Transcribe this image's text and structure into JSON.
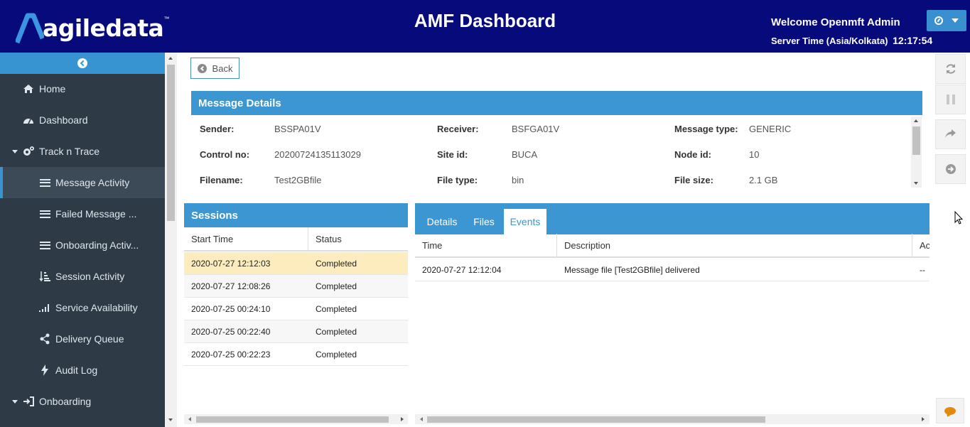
{
  "header": {
    "logo_text": "agiledata",
    "logo_tm": "™",
    "title": "AMF Dashboard",
    "welcome": "Welcome Openmft Admin",
    "server_time_label": "Server Time (Asia/Kolkata)",
    "server_time_value": "12:17:54",
    "user_icon": "dashboard-gauge-icon"
  },
  "sidebar": {
    "items": [
      {
        "label": "Home",
        "icon": "home-icon"
      },
      {
        "label": "Dashboard",
        "icon": "dashboard-icon"
      },
      {
        "label": "Track n Trace",
        "icon": "gears-icon"
      },
      {
        "label": "Message Activity",
        "icon": "bars-icon"
      },
      {
        "label": "Failed Message ...",
        "icon": "bars-icon"
      },
      {
        "label": "Onboarding Activ...",
        "icon": "bars-icon"
      },
      {
        "label": "Session Activity",
        "icon": "sort-amount-icon"
      },
      {
        "label": "Service Availability",
        "icon": "signal-icon"
      },
      {
        "label": "Delivery Queue",
        "icon": "share-alt-icon"
      },
      {
        "label": "Audit Log",
        "icon": "bolt-icon"
      },
      {
        "label": "Onboarding",
        "icon": "sign-in-icon"
      }
    ]
  },
  "back_button": {
    "label": "Back"
  },
  "message_details": {
    "title": "Message Details",
    "fields": [
      {
        "label": "Sender:",
        "value": "BSSPA01V"
      },
      {
        "label": "Receiver:",
        "value": "BSFGA01V"
      },
      {
        "label": "Message type:",
        "value": "GENERIC"
      },
      {
        "label": "Control no:",
        "value": "20200724135113029"
      },
      {
        "label": "Site id:",
        "value": "BUCA"
      },
      {
        "label": "Node id:",
        "value": "10"
      },
      {
        "label": "Filename:",
        "value": "Test2GBfile"
      },
      {
        "label": "File type:",
        "value": "bin"
      },
      {
        "label": "File size:",
        "value": "2.1 GB"
      }
    ]
  },
  "sessions": {
    "title": "Sessions",
    "columns": [
      "Start Time",
      "Status"
    ],
    "rows": [
      {
        "start_time": "2020-07-27 12:12:03",
        "status": "Completed"
      },
      {
        "start_time": "2020-07-27 12:08:26",
        "status": "Completed"
      },
      {
        "start_time": "2020-07-25 00:24:10",
        "status": "Completed"
      },
      {
        "start_time": "2020-07-25 00:22:40",
        "status": "Completed"
      },
      {
        "start_time": "2020-07-25 00:22:23",
        "status": "Completed"
      }
    ]
  },
  "detail_tabs": {
    "tabs": [
      "Details",
      "Files",
      "Events"
    ],
    "active": "Events",
    "columns": [
      "Time",
      "Description",
      "Ac"
    ],
    "rows": [
      {
        "time": "2020-07-27 12:12:04",
        "description": "Message file [Test2GBfile] delivered",
        "action": "--"
      }
    ]
  },
  "tools": {
    "icons": [
      "refresh-icon",
      "pause-icon",
      "share-icon",
      "arrow-circle-right-icon",
      "comment-icon"
    ]
  },
  "colors": {
    "header_bg": "#060a7a",
    "accent": "#3b96d1",
    "sidebar_bg": "#2e3a46",
    "selected_row": "#fdecbd",
    "chat_icon": "#e28a0c"
  }
}
